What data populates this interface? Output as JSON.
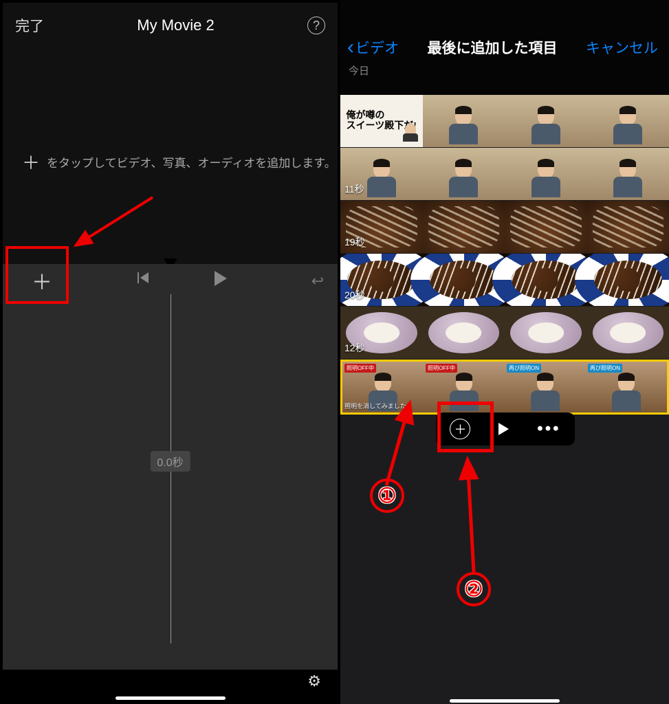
{
  "left": {
    "done": "完了",
    "title": "My Movie 2",
    "hint": "をタップしてビデオ、写真、オーディオを追加します。",
    "time": "0.0秒"
  },
  "right": {
    "back": "ビデオ",
    "title": "最後に追加した項目",
    "cancel": "キャンセル",
    "today": "今日",
    "clips": [
      {
        "duration": "",
        "title_card": "俺が噂の\nスイーツ殿下だ!"
      },
      {
        "duration": "11秒"
      },
      {
        "duration": "19秒"
      },
      {
        "duration": "20秒"
      },
      {
        "duration": "12秒"
      },
      {
        "duration": "",
        "tags": [
          "照明OFF中",
          "照明OFF中",
          "再び照明ON",
          "再び照明ON"
        ],
        "caption": "照明を消してみました"
      }
    ]
  },
  "annotations": {
    "step1": "①",
    "step2": "②"
  }
}
